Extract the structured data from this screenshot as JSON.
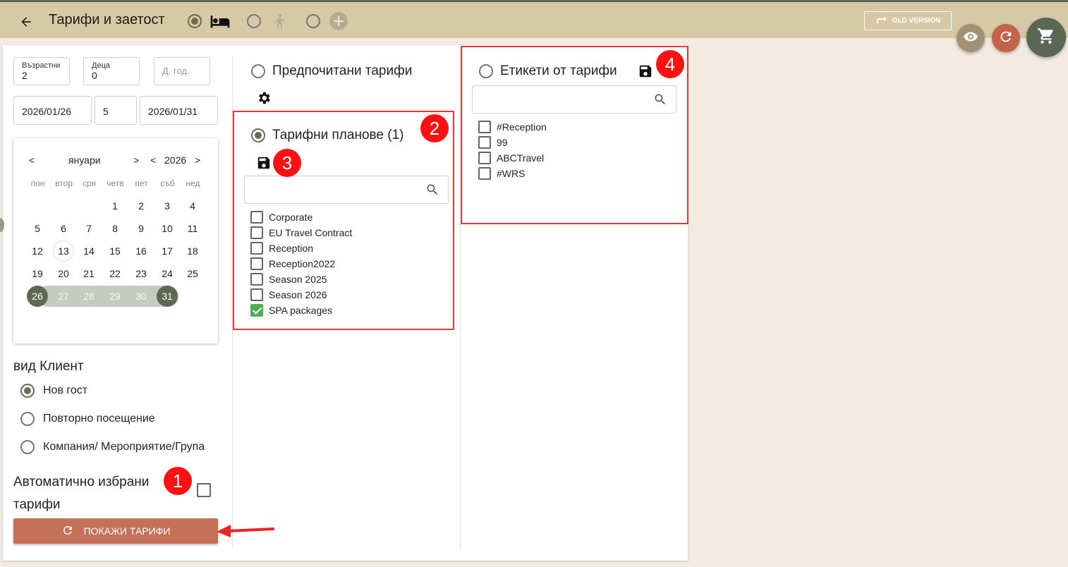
{
  "header": {
    "title": "Тарифи и заетост",
    "old_version": "OLD VERSION",
    "colors": {
      "bar": "#d7c9a6",
      "accent": "#596850"
    }
  },
  "search": {
    "adults": {
      "label": "Възрастни",
      "value": "2"
    },
    "children": {
      "label": "Деца",
      "value": "0"
    },
    "ages": {
      "placeholder": "Д. год."
    },
    "date_from": "2026/01/26",
    "nights": "5",
    "date_to": "2026/01/31"
  },
  "calendar": {
    "month": "януари",
    "year": "2026",
    "prev": "<",
    "next": ">",
    "weekdays": [
      "пон",
      "втор",
      "сря",
      "четв",
      "пет",
      "съб",
      "нед"
    ],
    "days": [
      "1",
      "2",
      "3",
      "4",
      "5",
      "6",
      "7",
      "8",
      "9",
      "10",
      "11",
      "12",
      "13",
      "14",
      "15",
      "16",
      "17",
      "18",
      "19",
      "20",
      "21",
      "22",
      "23",
      "24",
      "25",
      "26",
      "27",
      "28",
      "29",
      "30",
      "31"
    ]
  },
  "client": {
    "title": "вид Клиент",
    "options": [
      "Нов гост",
      "Повторно посещение",
      "Компания/ Мероприятие/Група"
    ]
  },
  "auto": {
    "line1": "Автоматично избрани",
    "line2": "тарифи"
  },
  "show_button": "ПОКАЖИ ТАРИФИ",
  "preferred": {
    "title": "Предпочитани тарифи"
  },
  "plans": {
    "title": "Тарифни планове (1)",
    "items": [
      {
        "label": "Corporate",
        "checked": false
      },
      {
        "label": "EU Travel Contract",
        "checked": false
      },
      {
        "label": "Reception",
        "checked": false
      },
      {
        "label": "Reception2022",
        "checked": false
      },
      {
        "label": "Season 2025",
        "checked": false
      },
      {
        "label": "Season 2026",
        "checked": false
      },
      {
        "label": "SPA packages",
        "checked": true
      }
    ]
  },
  "tags": {
    "title": "Етикети от тарифи",
    "items": [
      "#Reception",
      "99",
      "ABCTravel",
      "#WRS"
    ]
  },
  "badges": [
    "1",
    "2",
    "3",
    "4"
  ]
}
